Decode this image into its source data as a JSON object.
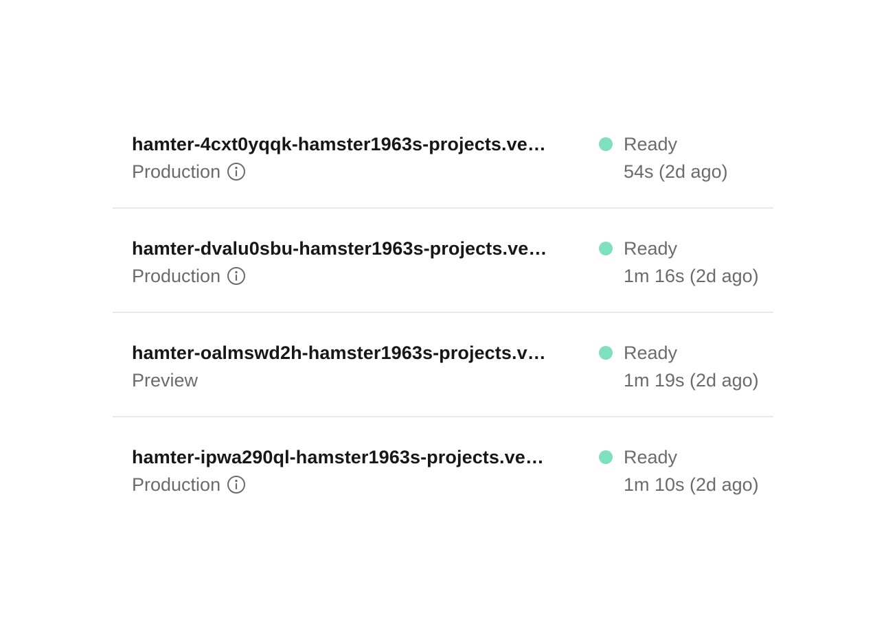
{
  "deployments": [
    {
      "url": "hamter-4cxt0yqqk-hamster1963s-projects.ve…",
      "environment": "Production",
      "has_info": true,
      "status": "Ready",
      "duration": "54s (2d ago)"
    },
    {
      "url": "hamter-dvalu0sbu-hamster1963s-projects.ve…",
      "environment": "Production",
      "has_info": true,
      "status": "Ready",
      "duration": "1m 16s (2d ago)"
    },
    {
      "url": "hamter-oalmswd2h-hamster1963s-projects.v…",
      "environment": "Preview",
      "has_info": false,
      "status": "Ready",
      "duration": "1m 19s (2d ago)"
    },
    {
      "url": "hamter-ipwa290ql-hamster1963s-projects.ve…",
      "environment": "Production",
      "has_info": true,
      "status": "Ready",
      "duration": "1m 10s (2d ago)"
    }
  ],
  "icons": {
    "info": "info-circle-icon",
    "status": "status-dot-icon"
  },
  "colors": {
    "status_ready": "#7fdfc0",
    "primary_text": "#171717",
    "secondary_text": "#6b6b6b",
    "divider": "#e8e8e8"
  }
}
